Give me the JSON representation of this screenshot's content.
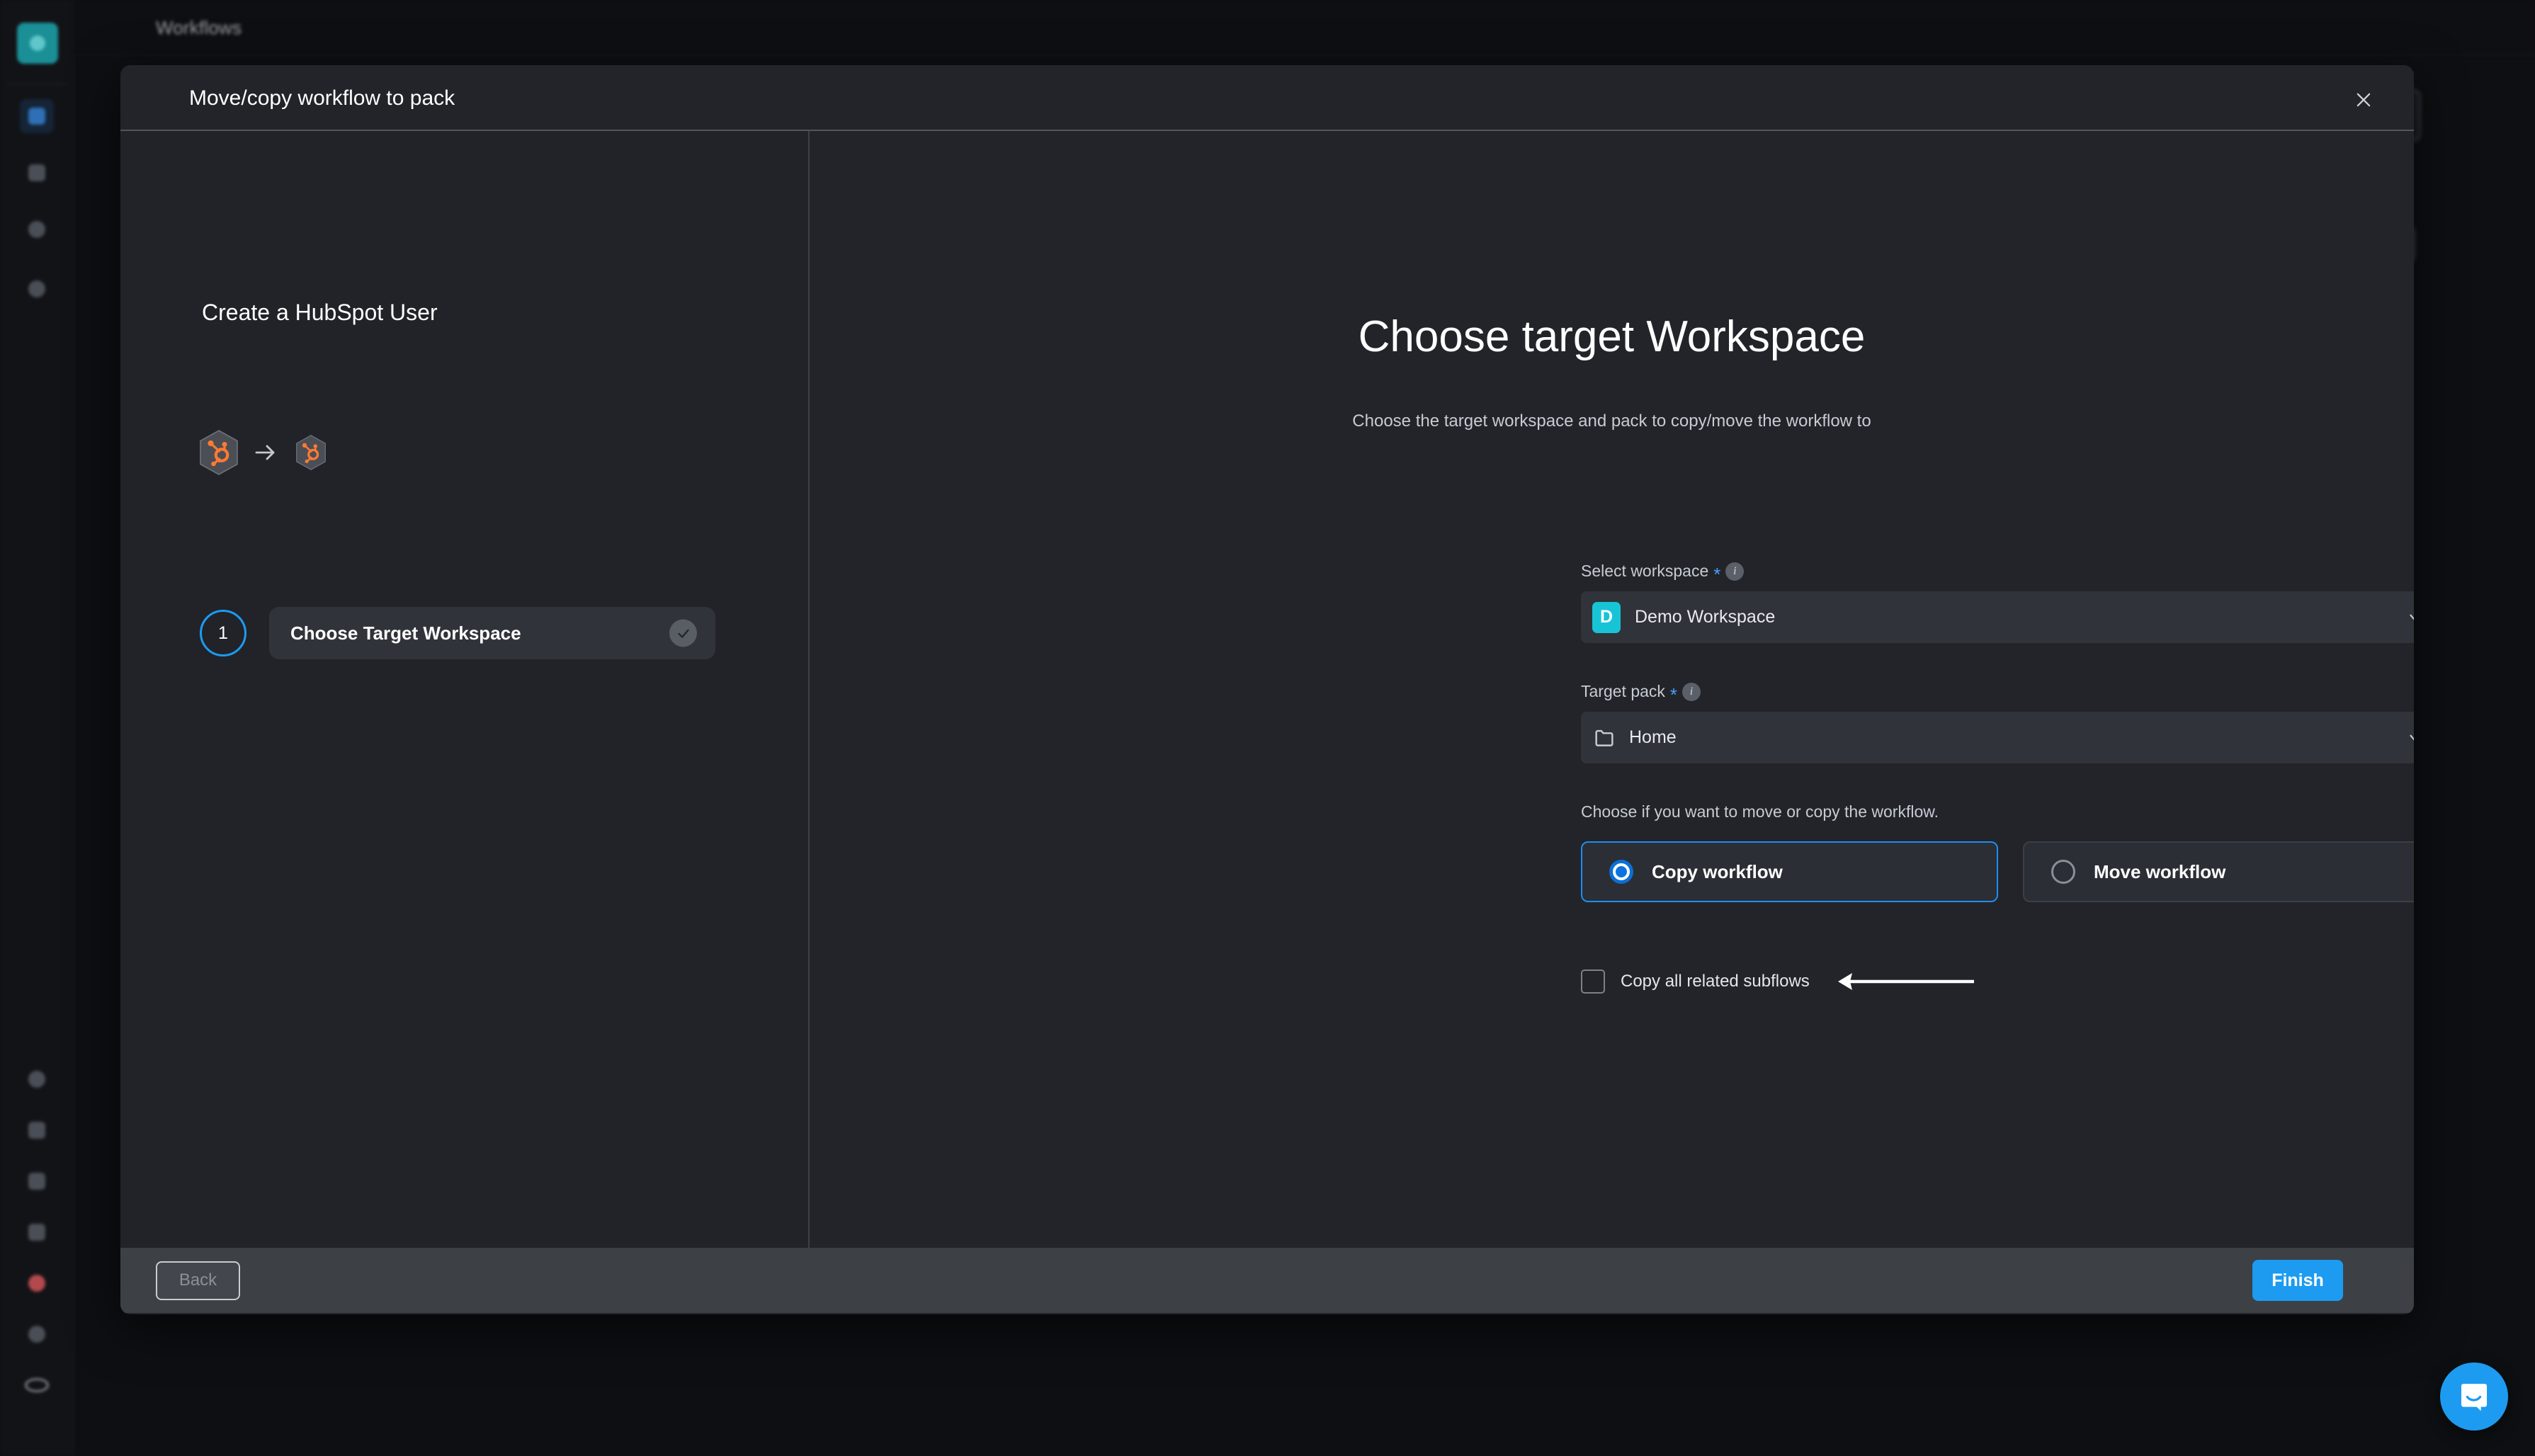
{
  "background": {
    "topbar_title": "Workflows",
    "rail_items": [
      {
        "name": "app-logo",
        "kind": "logo"
      },
      {
        "name": "rail-item-workflows",
        "kind": "selected"
      },
      {
        "name": "rail-item-inbox",
        "kind": "plain"
      },
      {
        "name": "rail-item-settings",
        "kind": "round"
      },
      {
        "name": "rail-item-profile",
        "kind": "round"
      },
      {
        "name": "rail-item-globe",
        "kind": "round"
      },
      {
        "name": "rail-item-bell",
        "kind": "plain"
      },
      {
        "name": "rail-item-lock",
        "kind": "plain"
      },
      {
        "name": "rail-item-note",
        "kind": "plain"
      },
      {
        "name": "rail-item-alert",
        "kind": "red"
      },
      {
        "name": "rail-item-help",
        "kind": "round"
      },
      {
        "name": "rail-item-user",
        "kind": "ring"
      }
    ]
  },
  "modal": {
    "title": "Move/copy workflow to pack",
    "close_label": "×"
  },
  "left_panel": {
    "workflow_title": "Create a HubSpot User",
    "source_app": "HubSpot",
    "target_app": "HubSpot",
    "transition_arrow": "→",
    "steps": [
      {
        "number": "1",
        "label": "Choose Target Workspace",
        "completed": true
      }
    ]
  },
  "main": {
    "heading": "Choose target Workspace",
    "subheading": "Choose the target workspace and pack to copy/move the workflow to",
    "fields": {
      "workspace": {
        "label": "Select workspace",
        "required_marker": "*",
        "info_marker": "i",
        "badge": "D",
        "value": "Demo Workspace"
      },
      "pack": {
        "label": "Target pack",
        "required_marker": "*",
        "info_marker": "i",
        "value": "Home"
      }
    },
    "mode": {
      "prompt": "Choose if you want to move or copy the workflow.",
      "options": [
        {
          "label": "Copy workflow",
          "selected": true
        },
        {
          "label": "Move workflow",
          "selected": false
        }
      ]
    },
    "subflows": {
      "label": "Copy all related subflows",
      "checked": false
    }
  },
  "footer": {
    "back_label": "Back",
    "finish_label": "Finish"
  },
  "colors": {
    "accent_blue": "#1d9bf0",
    "radio_blue": "#0b74e0",
    "workspace_badge": "#17c4d6",
    "hubspot_orange": "#ff7a33",
    "modal_bg": "#22242a",
    "footer_bg": "#3d4045",
    "page_bg": "#0e0f12"
  },
  "chat": {
    "launcher_name": "intercom-chat-launcher"
  }
}
